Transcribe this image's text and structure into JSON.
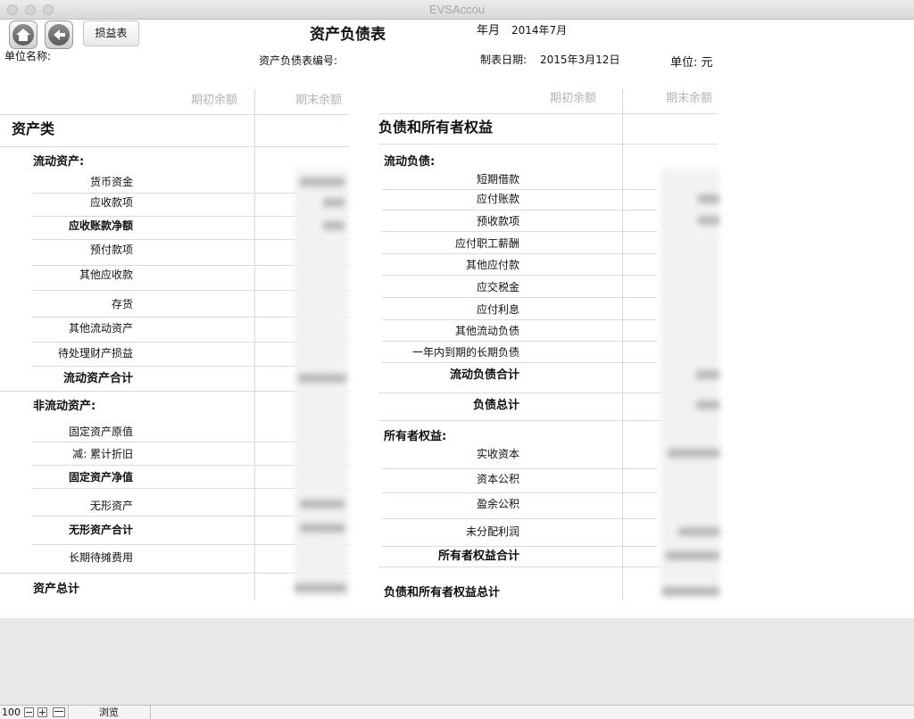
{
  "window": {
    "title": "EVSAccou"
  },
  "toolbar": {
    "home_icon": "home-icon",
    "back_icon": "back-arrow-icon",
    "income_statement_button": "损益表"
  },
  "report": {
    "title": "资产负债表",
    "period_label": "年月",
    "period_value": "2014年7月",
    "company_label": "单位名称:",
    "number_label": "资产负债表编号:",
    "date_label": "制表日期:",
    "date_value": "2015年3月12日",
    "unit_label": "单位: 元"
  },
  "columns": {
    "opening": "期初余额",
    "closing": "期末余额"
  },
  "assets": {
    "section_title": "资产类",
    "current_title": "流动资产:",
    "current_items": [
      "货币资金",
      "应收款项",
      "应收账款净额",
      "预付款项",
      "其他应收款",
      "存货",
      "其他流动资产",
      "待处理财产损益"
    ],
    "current_total": "流动资产合计",
    "noncurrent_title": "非流动资产:",
    "noncurrent_items": [
      "固定资产原值",
      "减: 累计折旧",
      "固定资产净值",
      "无形资产",
      "无形资产合计",
      "长期待摊费用"
    ],
    "total": "资产总计"
  },
  "liabilities": {
    "section_title": "负债和所有者权益",
    "current_title": "流动负债:",
    "current_items": [
      "短期借款",
      "应付账款",
      "预收款项",
      "应付职工薪酬",
      "其他应付款",
      "应交税金",
      "应付利息",
      "其他流动负债",
      "一年内到期的长期负债"
    ],
    "current_total": "流动负债合计",
    "liabilities_total": "负债总计",
    "equity_title": "所有者权益:",
    "equity_items": [
      "实收资本",
      "资本公积",
      "盈余公积",
      "未分配利润"
    ],
    "equity_total": "所有者权益合计",
    "grand_total": "负债和所有者权益总计"
  },
  "statusbar": {
    "zoom": "100",
    "mode": "浏览"
  },
  "colors": {
    "header_text": "#b3b3b3",
    "divider": "#d6d6d6",
    "grey_area": "#e8e8e8"
  }
}
